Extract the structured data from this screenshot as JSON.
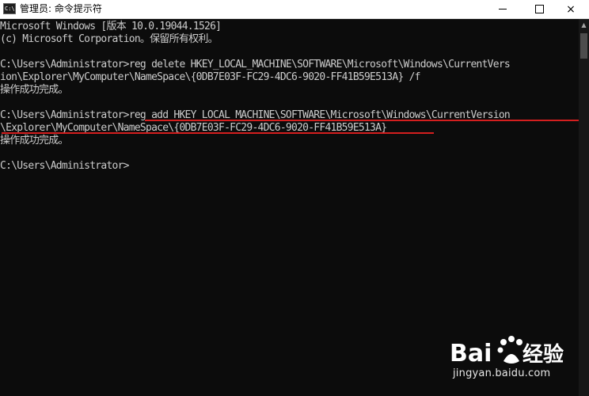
{
  "window": {
    "title": "管理员: 命令提示符",
    "icon_text": "C:\\",
    "buttons": {
      "minimize": "minimize-icon",
      "maximize": "maximize-icon",
      "close": "×"
    }
  },
  "console": {
    "lines": [
      "Microsoft Windows [版本 10.0.19044.1526]",
      "(c) Microsoft Corporation。保留所有权利。",
      "C:\\Users\\Administrator>reg delete HKEY_LOCAL_MACHINE\\SOFTWARE\\Microsoft\\Windows\\CurrentVers",
      "ion\\Explorer\\MyComputer\\NameSpace\\{0DB7E03F-FC29-4DC6-9020-FF41B59E513A} /f",
      "操作成功完成。",
      "C:\\Users\\Administrator>reg add HKEY_LOCAL_MACHINE\\SOFTWARE\\Microsoft\\Windows\\CurrentVersion",
      "\\Explorer\\MyComputer\\NameSpace\\{0DB7E03F-FC29-4DC6-9020-FF41B59E513A}",
      "操作成功完成。",
      "C:\\Users\\Administrator>"
    ],
    "highlight_color": "#d41f1f",
    "text_color": "#cccccc",
    "background_color": "#0c0c0c"
  },
  "watermark": {
    "logo_text": "Bai",
    "logo_text_2": "经验",
    "url": "jingyan.baidu.com"
  }
}
